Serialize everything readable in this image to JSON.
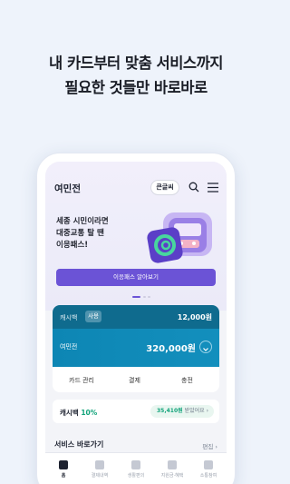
{
  "headline": [
    "내 카드부터 맞춤 서비스까지",
    "필요한 것들만 바로바로"
  ],
  "appbar": {
    "title": "여민전",
    "font_size_button": "큰글씨"
  },
  "hero": {
    "lines": [
      "세종 시민이라면",
      "대중교통 탈 땐",
      "이응패스!"
    ],
    "button": "이응패스 알아보기"
  },
  "card": {
    "cashbag_label": "캐시백",
    "cashbag_badge": "사용",
    "cashbag_amount": "12,000원",
    "name": "여민전",
    "balance": "320,000원",
    "actions": [
      "카드 관리",
      "결제",
      "충전"
    ]
  },
  "cashback": {
    "label": "캐시백",
    "percent": "10%",
    "chip_amount": "35,410원",
    "chip_text": "받았어요"
  },
  "services": {
    "title": "서비스 바로가기",
    "edit": "편집"
  },
  "tabs": [
    "홈",
    "결제내역",
    "생활편의",
    "지원금·혜택",
    "소통참여"
  ],
  "colors": {
    "accent": "#6b53d6",
    "card": "#0d86b4",
    "cashback": "#12a37a"
  }
}
